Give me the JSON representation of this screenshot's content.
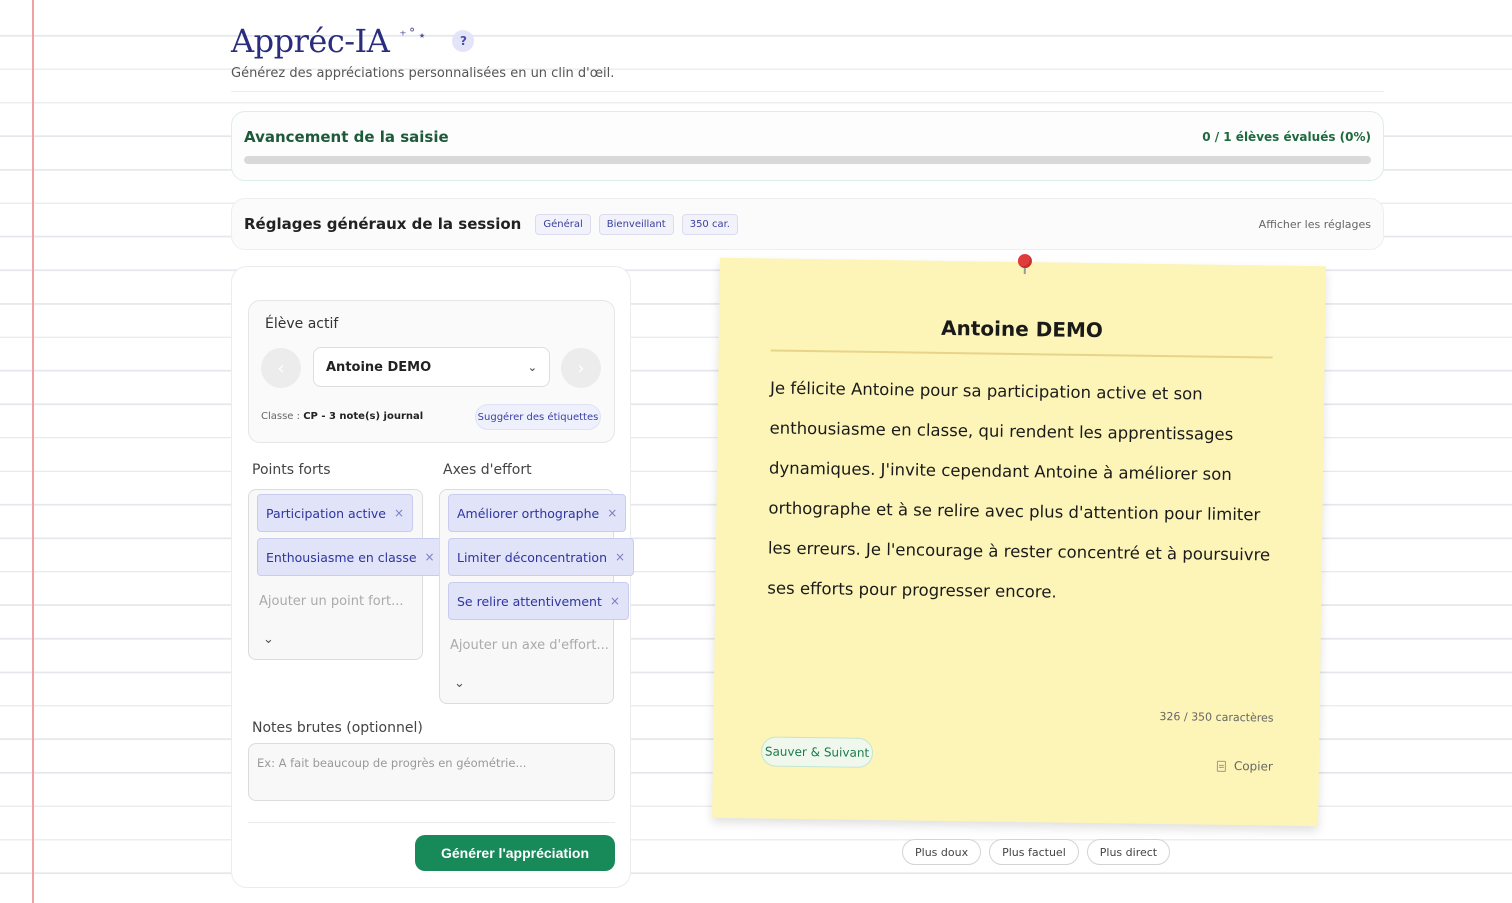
{
  "app": {
    "title": "Appréc-IA",
    "sparkles": "⁺˚⋆",
    "help": "?",
    "subtitle": "Générez des appréciations personnalisées en un clin d'œil."
  },
  "progress": {
    "title": "Avancement de la saisie",
    "count": "0 / 1 élèves évalués (0%)",
    "fraction": 0
  },
  "settings": {
    "title": "Réglages généraux de la session",
    "chips": [
      "Général",
      "Bienveillant",
      "350 car."
    ],
    "toggle_label": "Afficher les réglages"
  },
  "student": {
    "section_label": "Élève actif",
    "prev_icon": "‹",
    "next_icon": "›",
    "selected": "Antoine DEMO",
    "class_prefix": "Classe : ",
    "class_name": "CP",
    "notes_count": " - 3 note(s) journal",
    "suggest_label": "Suggérer des étiquettes"
  },
  "strengths": {
    "label": "Points forts",
    "tags": [
      "Participation active",
      "Enthousiasme en classe"
    ],
    "placeholder": "Ajouter un point fort..."
  },
  "efforts": {
    "label": "Axes d'effort",
    "tags": [
      "Améliorer orthographe",
      "Limiter déconcentration",
      "Se relire attentivement"
    ],
    "placeholder": "Ajouter un axe d'effort..."
  },
  "notes": {
    "label": "Notes brutes (optionnel)",
    "placeholder": "Ex: A fait beaucoup de progrès en géométrie..."
  },
  "generate_label": "Générer l'appréciation",
  "result": {
    "name": "Antoine DEMO",
    "text": "Je félicite Antoine pour sa participation active et son enthousiasme en classe, qui rendent les apprentissages dynamiques. J'invite cependant Antoine à améliorer son orthographe et à se relire avec plus d'attention pour limiter les erreurs. Je l'encourage à rester concentré et à poursuivre ses efforts pour progresser encore.",
    "char_count": "326 / 350 caractères",
    "save_next_label": "Sauver & Suivant",
    "copy_label": "Copier"
  },
  "tones": [
    "Plus doux",
    "Plus factuel",
    "Plus direct"
  ],
  "colors": {
    "accent": "#188a5a",
    "brand": "#2a2d7e",
    "sticky": "#fdf4b8",
    "tag_bg": "#e1e3f8",
    "margin_line": "#f2a0a0"
  }
}
